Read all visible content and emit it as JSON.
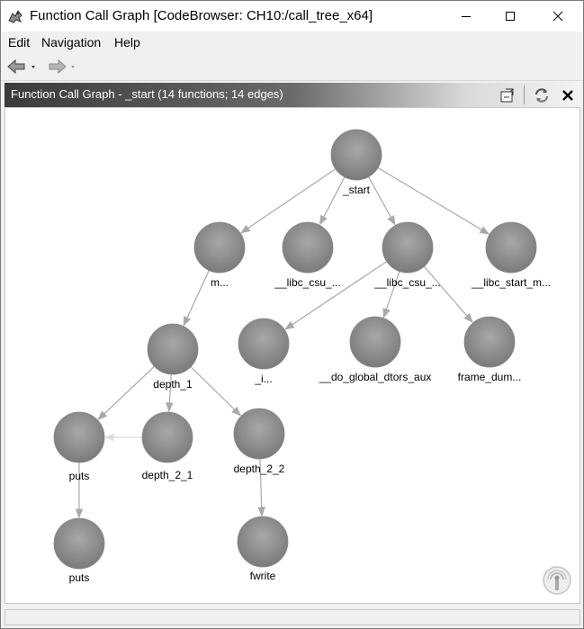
{
  "window": {
    "title": "Function Call Graph [CodeBrowser: CH10:/call_tree_x64]"
  },
  "menubar": {
    "items": [
      "Edit",
      "Navigation",
      "Help"
    ]
  },
  "panel": {
    "title": "Function Call Graph - _start (14 functions; 14 edges)"
  },
  "graph": {
    "nodes": [
      {
        "id": "start",
        "label": "_start"
      },
      {
        "id": "main",
        "label": "m..."
      },
      {
        "id": "libc_csu1",
        "label": "__libc_csu_..."
      },
      {
        "id": "libc_csu2",
        "label": "__libc_csu_..."
      },
      {
        "id": "libc_start_main",
        "label": "__libc_start_m..."
      },
      {
        "id": "depth_1",
        "label": "depth_1"
      },
      {
        "id": "init",
        "label": "_i..."
      },
      {
        "id": "do_global_dtors_aux",
        "label": "__do_global_dtors_aux"
      },
      {
        "id": "frame_dummy",
        "label": "frame_dum..."
      },
      {
        "id": "puts1",
        "label": "puts"
      },
      {
        "id": "depth_2_1",
        "label": "depth_2_1"
      },
      {
        "id": "depth_2_2",
        "label": "depth_2_2"
      },
      {
        "id": "puts2",
        "label": "puts"
      },
      {
        "id": "fwrite",
        "label": "fwrite"
      }
    ],
    "edges": [
      [
        "start",
        "main"
      ],
      [
        "start",
        "libc_csu1"
      ],
      [
        "start",
        "libc_csu2"
      ],
      [
        "start",
        "libc_start_main"
      ],
      [
        "main",
        "depth_1"
      ],
      [
        "libc_csu2",
        "init"
      ],
      [
        "libc_csu2",
        "do_global_dtors_aux"
      ],
      [
        "libc_csu2",
        "frame_dummy"
      ],
      [
        "depth_1",
        "puts1"
      ],
      [
        "depth_1",
        "depth_2_1"
      ],
      [
        "depth_1",
        "depth_2_2"
      ],
      [
        "depth_2_1",
        "puts1"
      ],
      [
        "puts1",
        "puts2"
      ],
      [
        "depth_2_2",
        "fwrite"
      ]
    ]
  },
  "colors": {
    "node_fill": "#9a9a9a",
    "node_fill_dark": "#7c7c7c",
    "edge": "#a9a9a9",
    "edge_faint": "#dcdcdc"
  }
}
